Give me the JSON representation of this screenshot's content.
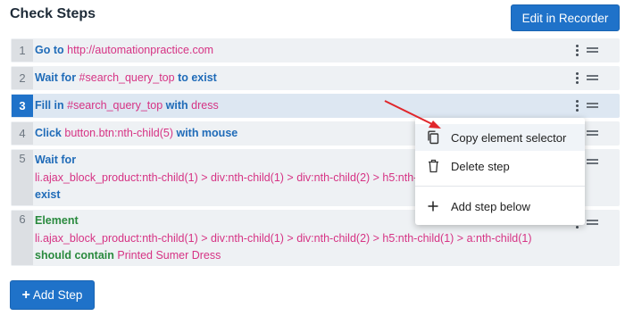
{
  "header": {
    "title": "Check Steps",
    "edit_button": "Edit in Recorder"
  },
  "steps": [
    {
      "number": "1",
      "parts": [
        {
          "t": "Go to",
          "c": "kw"
        },
        {
          "t": "http://automationpractice.com",
          "c": "val"
        }
      ]
    },
    {
      "number": "2",
      "parts": [
        {
          "t": "Wait for",
          "c": "kw"
        },
        {
          "t": "#search_query_top",
          "c": "val"
        },
        {
          "t": "to exist",
          "c": "kw"
        }
      ]
    },
    {
      "number": "3",
      "parts": [
        {
          "t": "Fill in",
          "c": "kw"
        },
        {
          "t": "#search_query_top",
          "c": "val"
        },
        {
          "t": "with",
          "c": "kw"
        },
        {
          "t": "dress",
          "c": "val"
        }
      ]
    },
    {
      "number": "4",
      "parts": [
        {
          "t": "Click",
          "c": "kw"
        },
        {
          "t": "button.btn:nth-child(5)",
          "c": "val"
        },
        {
          "t": "with mouse",
          "c": "kw"
        }
      ]
    },
    {
      "number": "5",
      "lines": [
        [
          {
            "t": "Wait for",
            "c": "kw"
          }
        ],
        [
          {
            "t": "li.ajax_block_product:nth-child(1) > div:nth-child(1) > div:nth-child(2) > h5:nth-",
            "c": "val"
          }
        ],
        [
          {
            "t": "exist",
            "c": "kw"
          }
        ]
      ]
    },
    {
      "number": "6",
      "lines": [
        [
          {
            "t": "Element",
            "c": "kw-green"
          }
        ],
        [
          {
            "t": "li.ajax_block_product:nth-child(1) > div:nth-child(1) > div:nth-child(2) > h5:nth-child(1) > a:nth-child(1)",
            "c": "val"
          }
        ],
        [
          {
            "t": "should contain",
            "c": "kw-green"
          },
          {
            "t": "Printed Sumer Dress",
            "c": "val"
          }
        ]
      ]
    }
  ],
  "context_menu": {
    "copy": "Copy element selector",
    "delete": "Delete step",
    "add": "Add step below"
  },
  "add_step_button": "Add Step",
  "icons": [
    "kebab-icon",
    "drag-handle-icon",
    "copy-icon",
    "trash-icon",
    "plus-icon",
    "arrow-annotation"
  ],
  "colors": {
    "accent": "#1f72c9",
    "keyword": "#1f6bb8",
    "value": "#d63384",
    "success": "#2a8a3e",
    "annotation": "#e0262b"
  }
}
